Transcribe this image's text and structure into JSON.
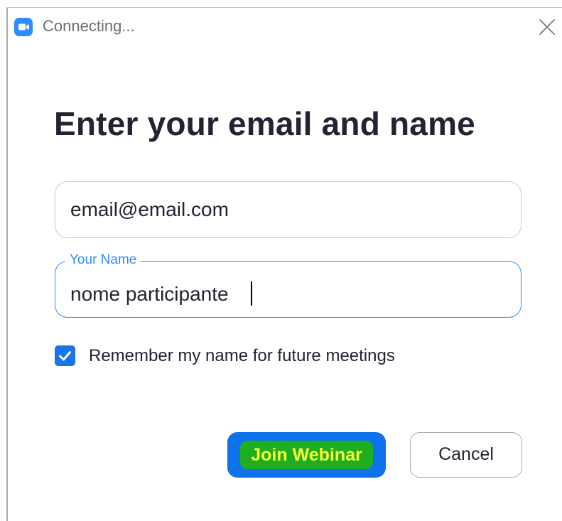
{
  "window": {
    "title": "Connecting..."
  },
  "dialog": {
    "heading": "Enter your email and name",
    "email_field": {
      "value": "email@email.com",
      "placeholder": ""
    },
    "name_field": {
      "label": "Your Name",
      "value": "nome participante"
    },
    "remember_checkbox": {
      "label": "Remember my name for future meetings",
      "checked": true
    },
    "buttons": {
      "join_label": "Join Webinar",
      "cancel_label": "Cancel"
    }
  },
  "colors": {
    "accent": "#2d8cff",
    "join_button": "#0e72ed",
    "checkbox": "#1a73e8",
    "heading_text": "#232333",
    "highlight_green": "#1fae1f",
    "highlight_text": "#f5ff3a"
  },
  "icons": {
    "app": "zoom-video-icon",
    "close": "close-icon",
    "check": "checkmark-icon"
  }
}
